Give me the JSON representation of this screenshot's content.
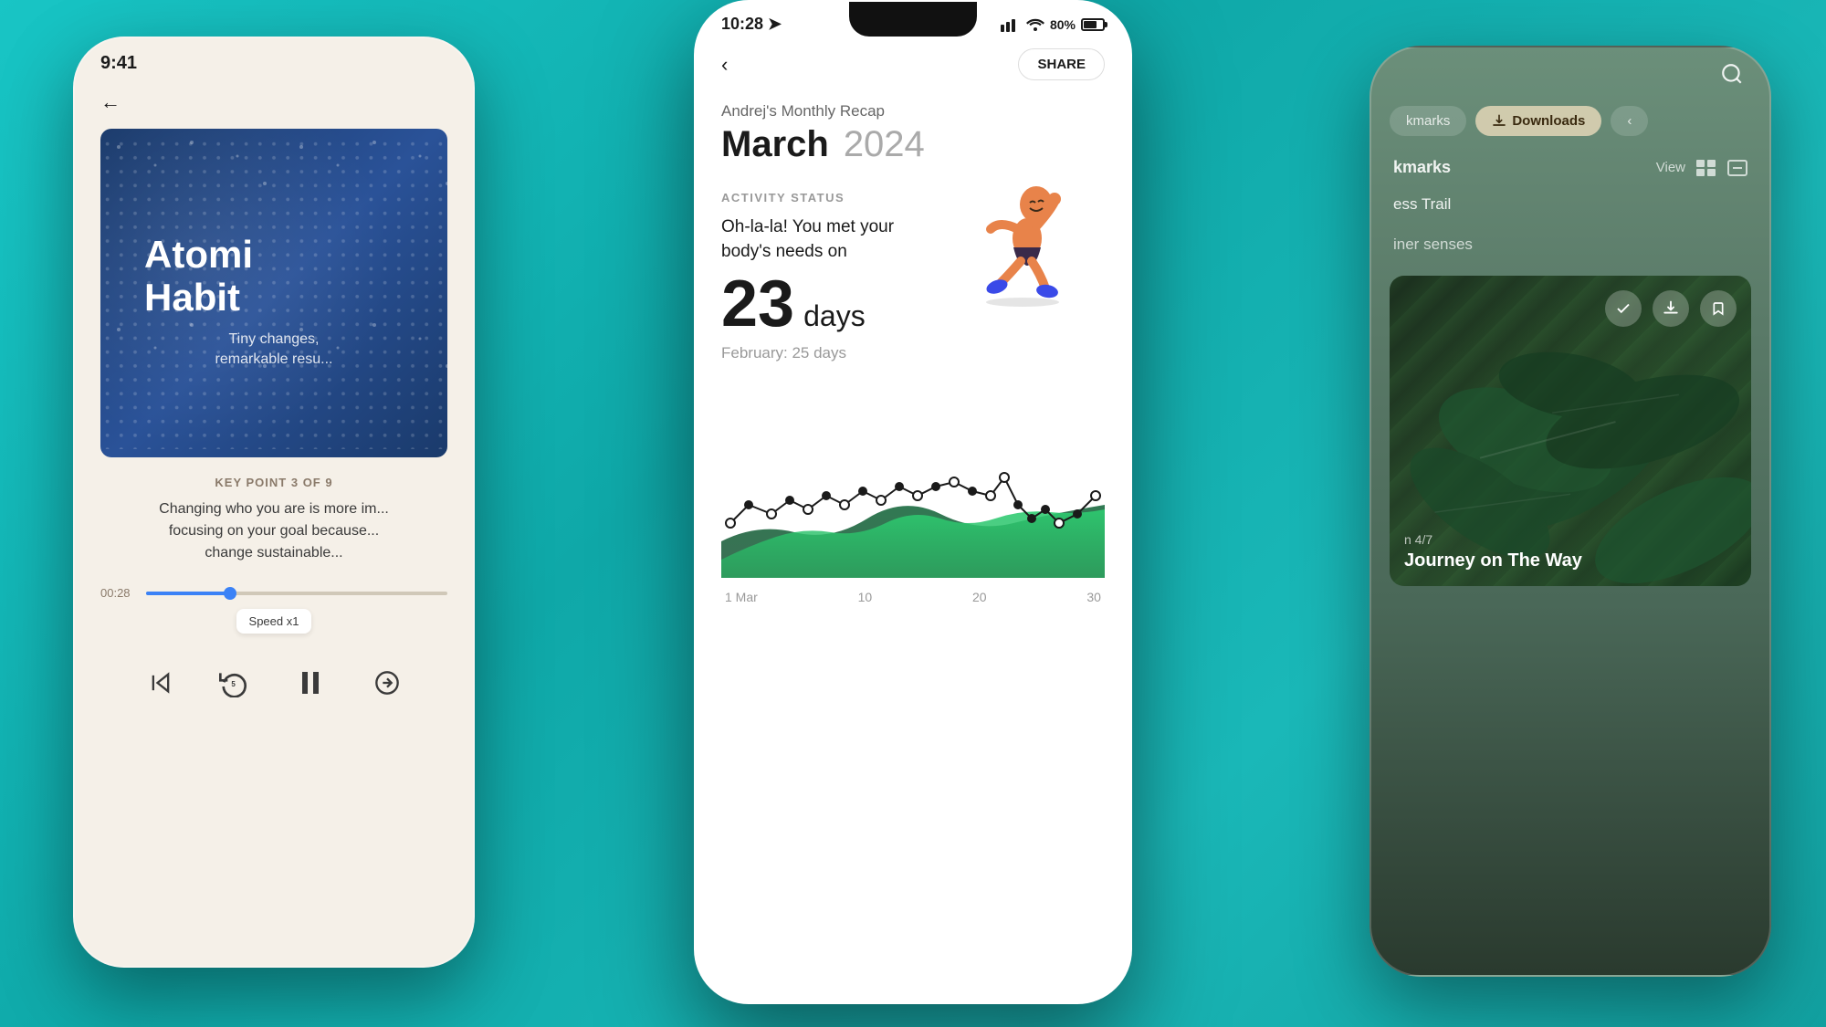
{
  "background": {
    "color": "#1ab5b5"
  },
  "left_phone": {
    "status_bar": {
      "time": "9:41"
    },
    "book": {
      "title_line1": "Atomi",
      "title_line2": "Habit",
      "subtitle_line1": "Tiny changes,",
      "subtitle_line2": "remarkable resu..."
    },
    "key_point": {
      "label": "KEY POINT 3 OF 9",
      "text": "Changing who you are is more im... focusing on your goal because... change sustainable..."
    },
    "audio": {
      "time": "00:28",
      "speed": "Speed x1"
    },
    "controls": {
      "skip_back": "⏮",
      "replay": "↺",
      "pause": "⏸",
      "forward": "→"
    }
  },
  "center_phone": {
    "status_bar": {
      "time": "10:28"
    },
    "header": {
      "share_label": "SHARE"
    },
    "recap": {
      "subtitle": "Andrej's Monthly Recap",
      "title": "March",
      "year": "2024"
    },
    "activity": {
      "label": "ACTIVITY STATUS",
      "text_line1": "Oh-la-la! You met your",
      "text_line2": "body's needs on",
      "days_number": "23",
      "days_label": "days",
      "prev_month": "February: 25 days"
    },
    "chart": {
      "x_labels": [
        "1 Mar",
        "10",
        "20",
        "30"
      ]
    }
  },
  "right_phone": {
    "tabs": [
      {
        "label": "kmarks",
        "active": false
      },
      {
        "label": "Downloads",
        "active": true,
        "icon": "⬇"
      }
    ],
    "bookmarks_section": {
      "title": "kmarks",
      "view_label": "View"
    },
    "list_items": [
      {
        "text": "ess Trail"
      },
      {
        "text": "iner senses"
      }
    ],
    "card": {
      "episode": "n 4/7",
      "title": "Journey on The Way"
    },
    "search_icon": "🔍"
  }
}
